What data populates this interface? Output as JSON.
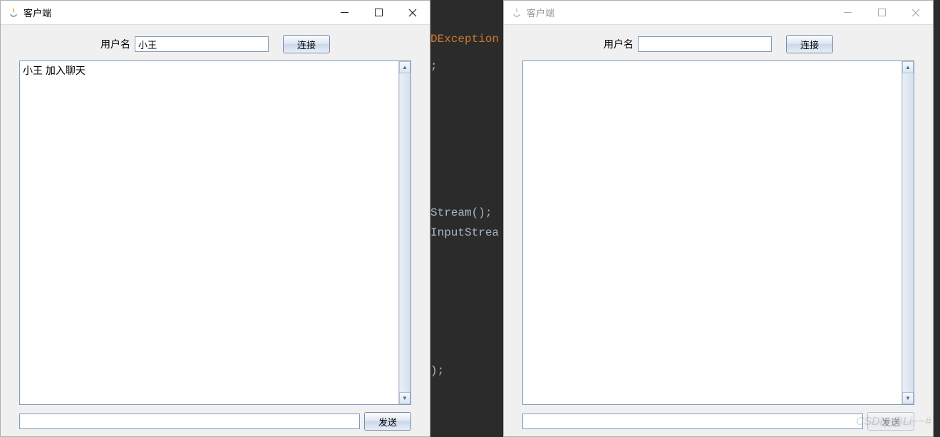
{
  "window1": {
    "title": "客户端",
    "username_label": "用户名",
    "username_value": "小王",
    "connect_label": "连接",
    "chat_content": "小王 加入聊天",
    "send_label": "发送",
    "message_value": ""
  },
  "window2": {
    "title": "客户端",
    "username_label": "用户名",
    "username_value": "",
    "connect_label": "连接",
    "chat_content": "",
    "send_label": "发送",
    "message_value": ""
  },
  "editor": {
    "line1": "DException",
    "line2": ";",
    "line3": "Stream();",
    "line4": "InputStrea",
    "line5": ");"
  },
  "watermark": "CSDN @Li~~#"
}
